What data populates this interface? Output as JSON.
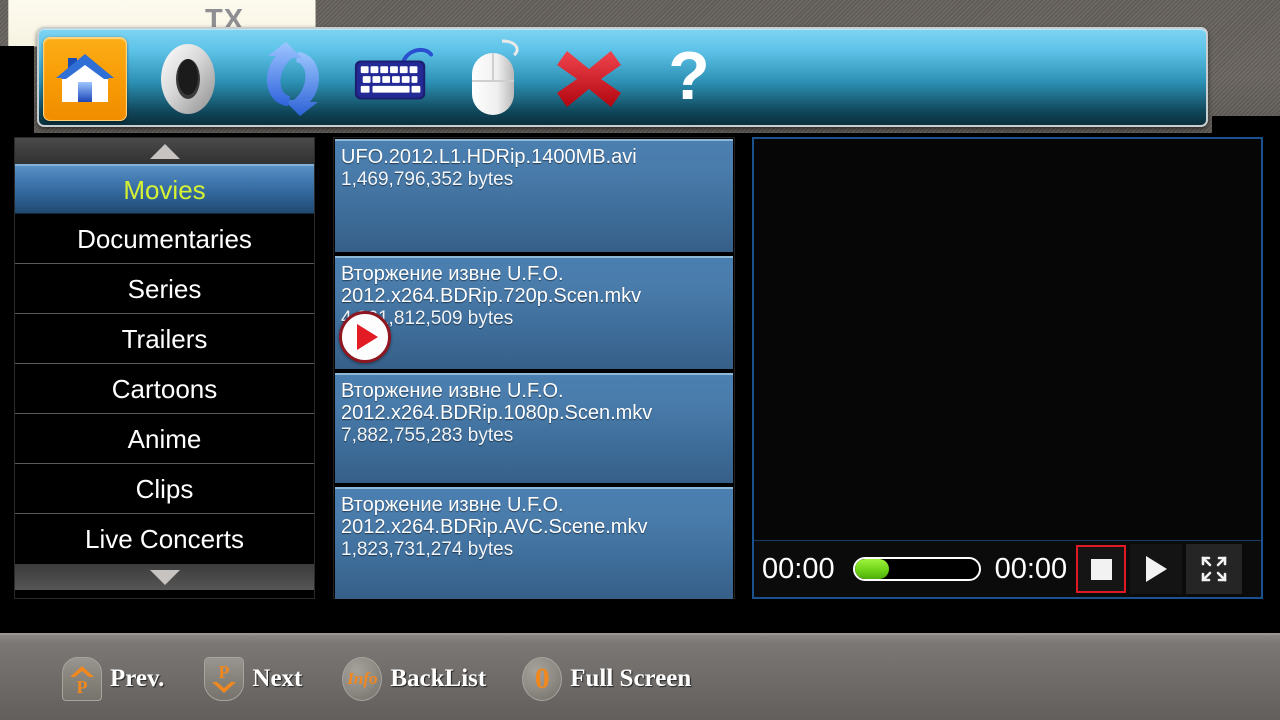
{
  "desktop": {
    "bg_window_text": "TX",
    "stripe_color": "#6f6a65"
  },
  "toolbar": {
    "items": [
      {
        "icon": "home-icon",
        "label": "Home",
        "selected": true
      },
      {
        "icon": "zero-key-icon",
        "label": "0"
      },
      {
        "icon": "refresh-sync-icon",
        "label": "Refresh"
      },
      {
        "icon": "keyboard-icon",
        "label": "Keyboard"
      },
      {
        "icon": "mouse-icon",
        "label": "Mouse"
      },
      {
        "icon": "close-x-icon",
        "label": "Close"
      },
      {
        "icon": "help-question-icon",
        "label": "Help"
      }
    ],
    "accent_selected": "#f89c06",
    "gradient_top": "#7ed4f2",
    "gradient_bottom": "#0b2f3c"
  },
  "sidebar": {
    "scroll_up": "scroll-up-arrow",
    "scroll_down": "scroll-down-arrow",
    "selected_index": 0,
    "selected_text_color": "#d6f233",
    "items": [
      {
        "label": "Movies"
      },
      {
        "label": "Documentaries"
      },
      {
        "label": "Series"
      },
      {
        "label": "Trailers"
      },
      {
        "label": "Cartoons"
      },
      {
        "label": "Anime"
      },
      {
        "label": "Clips"
      },
      {
        "label": "Live Concerts"
      }
    ]
  },
  "filelist": {
    "files": [
      {
        "name_line1": "UFO.2012.L1.HDRip.1400MB.avi",
        "name_line2": "",
        "size": "1,469,796,352 bytes",
        "playing": false
      },
      {
        "name_line1": "Вторжение извне U.F.O.",
        "name_line2": "2012.x264.BDRip.720p.Scen.mkv",
        "size": "4,361,812,509 bytes",
        "playing": true
      },
      {
        "name_line1": "Вторжение извне U.F.O.",
        "name_line2": "2012.x264.BDRip.1080p.Scen.mkv",
        "size": "7,882,755,283 bytes",
        "playing": false
      },
      {
        "name_line1": "Вторжение извне U.F.O.",
        "name_line2": "2012.x264.BDRip.AVC.Scene.mkv",
        "size": "1,823,731,274 bytes",
        "playing": false
      }
    ]
  },
  "player": {
    "border_color": "#19528f",
    "elapsed": "00:00",
    "duration": "00:00",
    "progress_percent": 28,
    "progress_color": "#6fd41a",
    "stop_highlight_color": "#e01a22",
    "buttons": [
      {
        "icon": "stop-icon",
        "label": "Stop",
        "highlighted": true
      },
      {
        "icon": "play-icon",
        "label": "Play",
        "highlighted": false
      },
      {
        "icon": "fullscreen-icon",
        "label": "Full Screen",
        "highlighted": false
      }
    ]
  },
  "bottombar": {
    "hints": [
      {
        "glyph": "P",
        "icon": "page-up-key-icon",
        "label": "Prev."
      },
      {
        "glyph": "P",
        "icon": "page-down-key-icon",
        "label": "Next"
      },
      {
        "glyph": "Info",
        "icon": "info-key-icon",
        "label": "BackList"
      },
      {
        "glyph": "0",
        "icon": "zero-key-icon",
        "label": "Full Screen"
      }
    ],
    "glyph_color": "#f0881f"
  }
}
